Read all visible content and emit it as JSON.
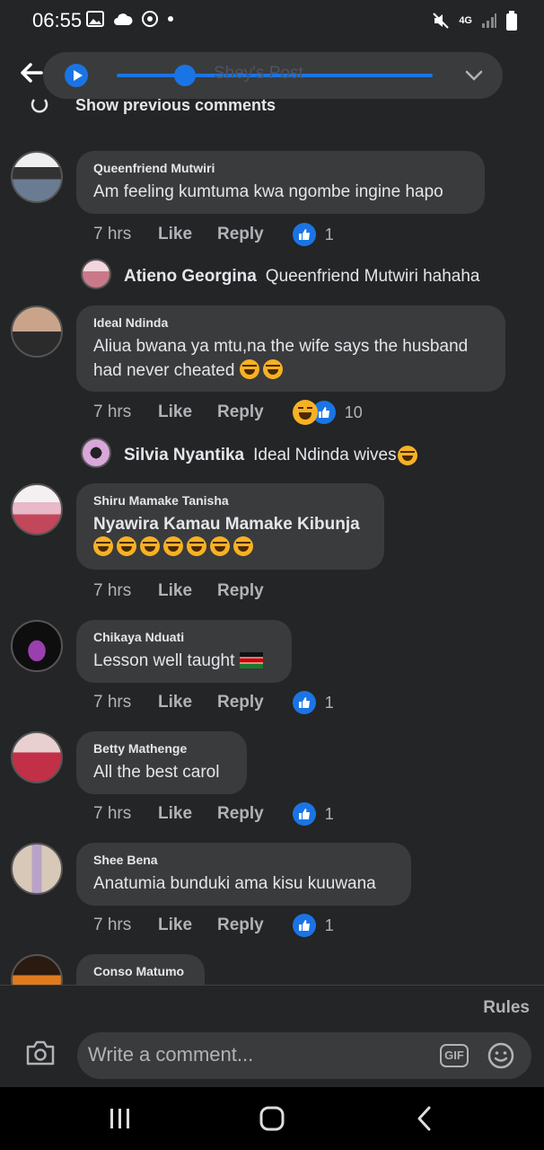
{
  "status": {
    "time": "06:55",
    "network": "4G"
  },
  "header": {
    "post_title": "Shey's Post"
  },
  "show_previous": "Show previous comments",
  "comments": [
    {
      "author": "Queenfriend Mutwiri",
      "text": "Am feeling kumtuma kwa ngombe ingine hapo",
      "time": "7 hrs",
      "like": "Like",
      "reply": "Reply",
      "reactions": "1"
    },
    {
      "author": "Ideal Ndinda",
      "text": "Aliua bwana ya mtu,na the wife says the husband had never cheated",
      "time": "7 hrs",
      "like": "Like",
      "reply": "Reply",
      "reactions": "10"
    },
    {
      "author": "Shiru Mamake Tanisha",
      "text": "Nyawira Kamau Mamake Kibunja",
      "time": "7 hrs",
      "like": "Like",
      "reply": "Reply"
    },
    {
      "author": "Chikaya Nduati",
      "text": "Lesson well taught",
      "time": "7 hrs",
      "like": "Like",
      "reply": "Reply",
      "reactions": "1"
    },
    {
      "author": "Betty Mathenge",
      "text": "All the best carol",
      "time": "7 hrs",
      "like": "Like",
      "reply": "Reply",
      "reactions": "1"
    },
    {
      "author": "Shee Bena",
      "text": "Anatumia bunduki ama kisu kuuwana",
      "time": "7 hrs",
      "like": "Like",
      "reply": "Reply",
      "reactions": "1"
    },
    {
      "author": "Conso Matumo"
    }
  ],
  "replies": [
    {
      "author": "Atieno Georgina",
      "text": "Queenfriend Mutwiri hahaha"
    },
    {
      "author": "Silvia Nyantika",
      "text": "Ideal Ndinda wives"
    }
  ],
  "footer": {
    "rules": "Rules",
    "comment_placeholder": "Write a comment...",
    "gif": "GIF"
  },
  "colors": {
    "background": "#242526",
    "bubble": "#3a3b3c",
    "accent": "#1b74e4",
    "muted": "#b0b3b8"
  },
  "icons": [
    "photo-icon",
    "cloud-icon",
    "soccer-icon",
    "mute-icon",
    "signal-icon",
    "battery-icon",
    "back-arrow-icon",
    "play-icon",
    "chevron-down-icon",
    "refresh-icon",
    "thumbs-up-icon",
    "haha-icon",
    "camera-icon",
    "gif-icon",
    "smiley-icon",
    "recent-apps-icon",
    "home-icon",
    "nav-back-icon"
  ]
}
